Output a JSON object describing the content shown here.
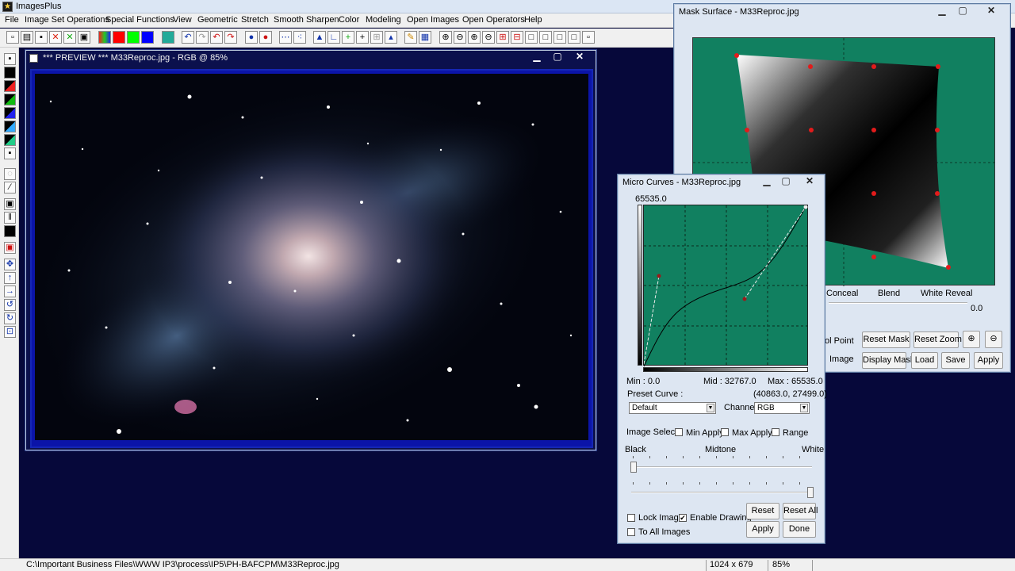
{
  "app": {
    "title": "ImagesPlus"
  },
  "menu": [
    "File",
    "Image Set Operations",
    "Special Functions",
    "View",
    "Geometric",
    "Stretch",
    "Smooth Sharpen",
    "Color",
    "Modeling",
    "Open Images",
    "Open Operators",
    "Help"
  ],
  "preview": {
    "title": "*** PREVIEW *** M33Reproc.jpg - RGB @ 85%"
  },
  "mask": {
    "title": "Mask Surface - M33Reproc.jpg",
    "labels": {
      "conceal": "Conceal",
      "blend": "Blend",
      "white_reveal": "White Reveal",
      "value": "0.0",
      "control_point": "ol Point",
      "image": "Image"
    },
    "buttons": {
      "reset_mask": "Reset Mask",
      "reset_zoom": "Reset Zoom",
      "display_mask": "Display Mask",
      "load": "Load",
      "save": "Save",
      "apply": "Apply"
    }
  },
  "micro": {
    "title": "Micro Curves - M33Reproc.jpg",
    "top_value": "65535.0",
    "min": "Min : 0.0",
    "mid": "Mid : 32767.0",
    "max": "Max : 65535.0",
    "preset_label": "Preset Curve :",
    "coords": "(40863.0, 27499.0)",
    "preset_value": "Default",
    "channel_label": "Channel:",
    "channel_value": "RGB",
    "image_select": "Image Select",
    "min_apply": "Min Apply",
    "max_apply": "Max Apply",
    "range": "Range",
    "black": "Black",
    "midtone": "Midtone",
    "white": "White",
    "lock_image": "Lock Image",
    "enable_drawing": "Enable Drawing",
    "to_all_images": "To All Images",
    "reset": "Reset",
    "reset_all": "Reset All",
    "apply": "Apply",
    "done": "Done",
    "enable_drawing_checked": true,
    "lock_image_checked": false
  },
  "status": {
    "path": "C:\\Important Business Files\\WWW IP3\\process\\IP5\\PH-BAFCPM\\M33Reproc.jpg",
    "dims": "1024 x 679",
    "zoom": "85%"
  },
  "colors": {
    "plot_green": "#118060",
    "desktop": "#06083a",
    "accent_red": "#e21b1b"
  }
}
